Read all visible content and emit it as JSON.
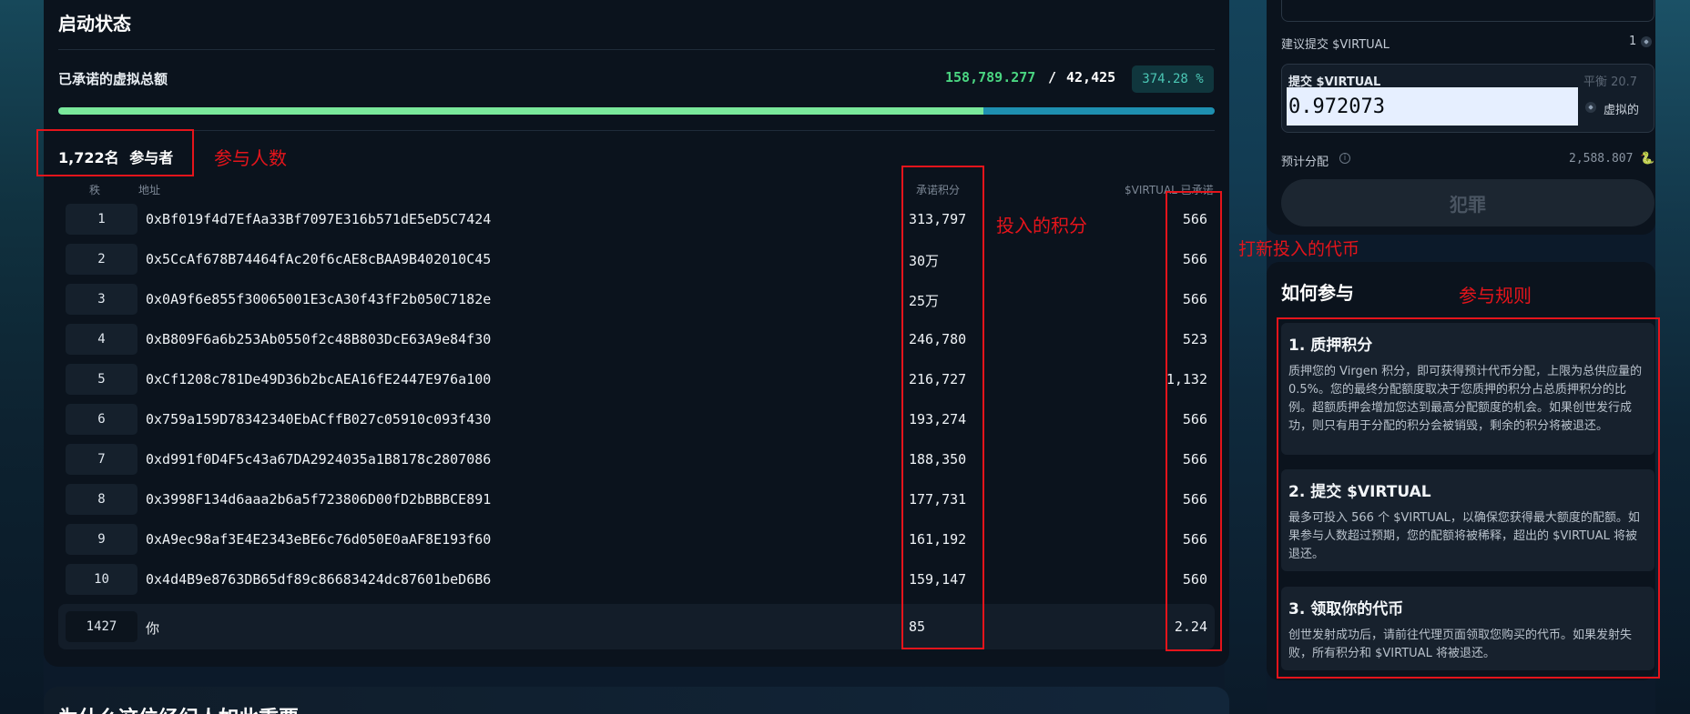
{
  "launch": {
    "title": "启动状态",
    "pledged_label": "已承诺的虚拟总额",
    "pledged_amount": "158,789.277",
    "slash": "/",
    "target_amount": "42,425",
    "percent": "374.28 %",
    "progress_fraction": 0.8,
    "participants_count": "1,722名",
    "participants_label": "参与者"
  },
  "table": {
    "headers": {
      "rank": "秩",
      "address": "地址",
      "points": "承诺积分",
      "virtual": "$VIRTUAL 已承诺"
    },
    "rows": [
      {
        "rank": "1",
        "address": "0xBf019f4d7EfAa33Bf7097E316b571dE5eD5C7424",
        "points": "313,797",
        "virtual": "566"
      },
      {
        "rank": "2",
        "address": "0x5CcAf678B74464fAc20f6cAE8cBAA9B402010C45",
        "points": "30万",
        "virtual": "566"
      },
      {
        "rank": "3",
        "address": "0x0A9f6e855f30065001E3cA30f43fF2b050C7182e",
        "points": "25万",
        "virtual": "566"
      },
      {
        "rank": "4",
        "address": "0xB809F6a6b253Ab0550f2c48B803DcE63A9e84f30",
        "points": "246,780",
        "virtual": "523"
      },
      {
        "rank": "5",
        "address": "0xCf1208c781De49D36b2bcAEA16fE2447E976a100",
        "points": "216,727",
        "virtual": "1,132"
      },
      {
        "rank": "6",
        "address": "0x759a159D78342340EbACffB027c05910c093f430",
        "points": "193,274",
        "virtual": "566"
      },
      {
        "rank": "7",
        "address": "0xd991f0D4F5c43a67DA2924035a1B8178c2807086",
        "points": "188,350",
        "virtual": "566"
      },
      {
        "rank": "8",
        "address": "0x3998F134d6aaa2b6a5f723806D00fD2bBBBCE891",
        "points": "177,731",
        "virtual": "566"
      },
      {
        "rank": "9",
        "address": "0xA9ec98af3E4E2343eBE6c76d050E0aAF8E193f60",
        "points": "161,192",
        "virtual": "566"
      },
      {
        "rank": "10",
        "address": "0x4d4B9e8763DB65df89c86683424dc87601beD6B6",
        "points": "159,147",
        "virtual": "560"
      }
    ],
    "you": {
      "rank": "1427",
      "address": "你",
      "points": "85",
      "virtual": "2.24"
    }
  },
  "annotations": {
    "participants": "参与人数",
    "points": "投入的积分",
    "virtual": "打新投入的代币",
    "rules": "参与规则"
  },
  "lower_section": {
    "title": "为什么这位经纪人如此重要"
  },
  "commit": {
    "suggest_label": "建议提交 $VIRTUAL",
    "suggest_value": "1",
    "submit_label": "提交 $VIRTUAL",
    "balance": "平衡 20.7",
    "amount_value": "0.972073",
    "unit": "虚拟的",
    "est_label": "预计分配",
    "est_value": "2,588.807",
    "est_icon": "🐍",
    "button_label": "犯罪"
  },
  "how": {
    "title": "如何参与",
    "steps": [
      {
        "title": "1. 质押积分",
        "body": "质押您的 Virgen 积分，即可获得预计代币分配，上限为总供应量的 0.5%。您的最终分配额度取决于您质押的积分占总质押积分的比例。超额质押会增加您达到最高分配额度的机会。如果创世发行成功，则只有用于分配的积分会被销毁，剩余的积分将被退还。"
      },
      {
        "title": "2. 提交 $VIRTUAL",
        "body": "最多可投入 566 个 $VIRTUAL，以确保您获得最大额度的配额。如果参与人数超过预期，您的配额将被稀释，超出的 $VIRTUAL 将被退还。"
      },
      {
        "title": "3. 领取你的代币",
        "body": "创世发射成功后，请前往代理页面领取您购买的代币。如果发射失败，所有积分和 $VIRTUAL 将被退还。"
      }
    ]
  },
  "colors": {
    "accent_green": "#4ad581",
    "progress_track": "#1e8fb0",
    "annotation_red": "#e5141b",
    "badge_teal": "#4bc7b5"
  }
}
